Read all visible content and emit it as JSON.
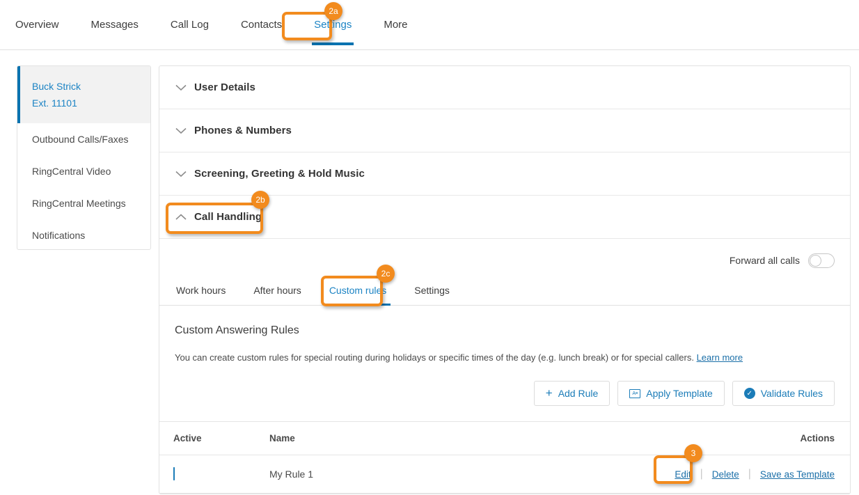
{
  "colors": {
    "accent_blue": "#1b83c4",
    "link_blue": "#1b6fa8",
    "annotation_orange": "#f28b1e",
    "toggle_on": "#1b7cb8",
    "sidebar_active_bg": "#f2f2f2",
    "border": "#e2e2e2"
  },
  "topnav": {
    "items": [
      {
        "label": "Overview",
        "active": false
      },
      {
        "label": "Messages",
        "active": false
      },
      {
        "label": "Call Log",
        "active": false
      },
      {
        "label": "Contacts",
        "active": false
      },
      {
        "label": "Settings",
        "active": true
      },
      {
        "label": "More",
        "active": false
      }
    ]
  },
  "sidebar": {
    "user": {
      "name": "Buck Strick",
      "extension": "Ext. 11101"
    },
    "items": [
      {
        "label": "Outbound Calls/Faxes"
      },
      {
        "label": "RingCentral Video"
      },
      {
        "label": "RingCentral Meetings"
      },
      {
        "label": "Notifications"
      }
    ]
  },
  "accordion": {
    "sections": [
      {
        "label": "User Details",
        "expanded": false,
        "icon": "chevron-down-icon"
      },
      {
        "label": "Phones & Numbers",
        "expanded": false,
        "icon": "chevron-down-icon"
      },
      {
        "label": "Screening, Greeting & Hold Music",
        "expanded": false,
        "icon": "chevron-down-icon"
      },
      {
        "label": "Call Handling",
        "expanded": true,
        "icon": "chevron-up-icon"
      }
    ]
  },
  "call_handling": {
    "forward_all_calls": {
      "label": "Forward all calls",
      "value": "off"
    },
    "tabs": [
      {
        "label": "Work hours",
        "active": false
      },
      {
        "label": "After hours",
        "active": false
      },
      {
        "label": "Custom rules",
        "active": true
      },
      {
        "label": "Settings",
        "active": false
      }
    ],
    "section_title": "Custom Answering Rules",
    "description": "You can create custom rules for special routing during holidays or specific times of the day (e.g. lunch break) or for special callers.",
    "learn_more": "Learn more",
    "buttons": [
      {
        "label": "Add Rule",
        "icon": "plus-icon"
      },
      {
        "label": "Apply Template",
        "icon": "template-icon"
      },
      {
        "label": "Validate Rules",
        "icon": "check-circle-icon"
      }
    ],
    "table": {
      "columns": {
        "active": "Active",
        "name": "Name",
        "actions": "Actions"
      },
      "rows": [
        {
          "active": "on",
          "name": "My Rule 1",
          "actions": {
            "edit": "Edit",
            "delete": "Delete",
            "save_as_template": "Save as Template"
          }
        }
      ]
    }
  },
  "annotations": [
    {
      "id": "2a",
      "target": "settings-nav-tab"
    },
    {
      "id": "2b",
      "target": "call-handling-section-header"
    },
    {
      "id": "2c",
      "target": "custom-rules-tab"
    },
    {
      "id": "3",
      "target": "edit-rule-link"
    }
  ]
}
